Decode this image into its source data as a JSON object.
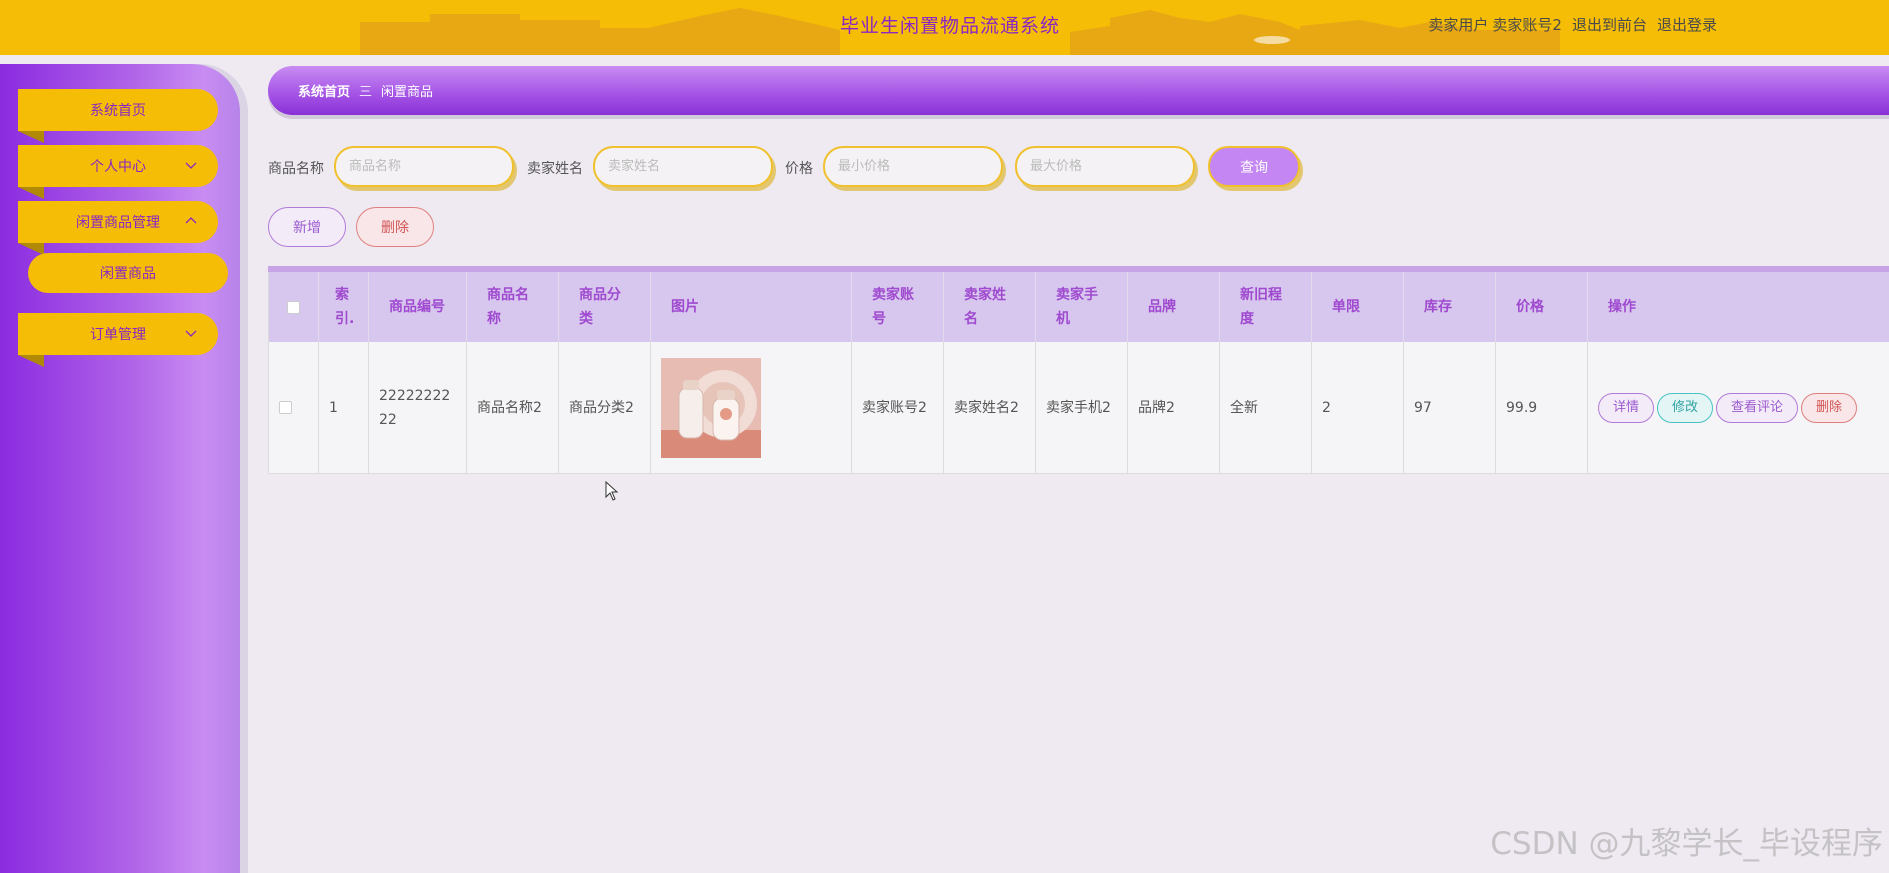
{
  "header": {
    "app_title": "毕业生闲置物品流通系统",
    "role": "卖家用户",
    "username": "卖家账号2",
    "to_front_label": "退出到前台",
    "logout_label": "退出登录",
    "bar_color": "#f5bd05"
  },
  "sidebar": {
    "items": [
      {
        "label": "系统首页",
        "icon": "none"
      },
      {
        "label": "个人中心",
        "icon": "chevron-down-icon"
      },
      {
        "label": "闲置商品管理",
        "icon": "chevron-up-icon"
      },
      {
        "label": "订单管理",
        "icon": "chevron-down-icon"
      }
    ],
    "sub_items": [
      {
        "label": "闲置商品",
        "parent": "闲置商品管理"
      }
    ]
  },
  "breadcrumb": {
    "home": "系统首页",
    "separator": "三",
    "current": "闲置商品"
  },
  "search": {
    "name_label": "商品名称",
    "name_placeholder": "商品名称",
    "seller_label": "卖家姓名",
    "seller_placeholder": "卖家姓名",
    "price_label": "价格",
    "min_placeholder": "最小价格",
    "max_placeholder": "最大价格",
    "query_label": "查询"
  },
  "actions": {
    "add_label": "新增",
    "delete_label": "删除"
  },
  "table": {
    "headers": {
      "index": "索引.",
      "code": "商品编号",
      "name": "商品名称",
      "category": "商品分类",
      "image": "图片",
      "seller_account": "卖家账号",
      "seller_name": "卖家姓名",
      "seller_phone": "卖家手机",
      "brand": "品牌",
      "condition": "新旧程度",
      "limit": "单限",
      "stock": "库存",
      "price": "价格",
      "ops": "操作"
    },
    "rows": [
      {
        "index": "1",
        "code": "2222222222",
        "name": "商品名称2",
        "category": "商品分类2",
        "image": "baby-bottle-product-photo",
        "seller_account": "卖家账号2",
        "seller_name": "卖家姓名2",
        "seller_phone": "卖家手机2",
        "brand": "品牌2",
        "condition": "全新",
        "limit": "2",
        "stock": "97",
        "price": "99.9"
      }
    ],
    "row_ops": {
      "detail": "详情",
      "edit": "修改",
      "review": "查看评论",
      "delete": "删除"
    }
  },
  "watermark": "CSDN @九黎学长_毕设程序"
}
